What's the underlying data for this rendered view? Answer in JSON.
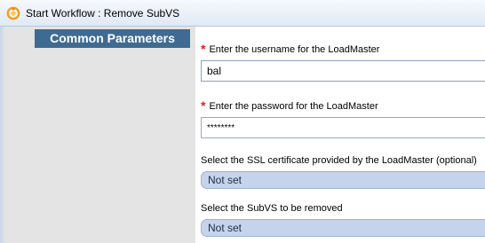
{
  "window": {
    "title": "Start Workflow : Remove SubVS"
  },
  "sidebar": {
    "section_header": "Common Parameters"
  },
  "form": {
    "username": {
      "label": "Enter the username for the LoadMaster",
      "required_marker": "*",
      "value": "bal"
    },
    "password": {
      "label": "Enter the password for the LoadMaster",
      "required_marker": "*",
      "value": "********"
    },
    "ssl_certificate": {
      "label": "Select the SSL certificate provided by the LoadMaster (optional)",
      "value": "Not set"
    },
    "subvs": {
      "label": "Select the SubVS to be removed",
      "value": "Not set"
    }
  },
  "icons": {
    "title_icon": "workflow-icon"
  },
  "colors": {
    "section_header_bg": "#3f6b92",
    "required_star": "#d9251c",
    "select_bg": "#c6d4eb",
    "sidebar_bg": "#e4e4e4"
  }
}
